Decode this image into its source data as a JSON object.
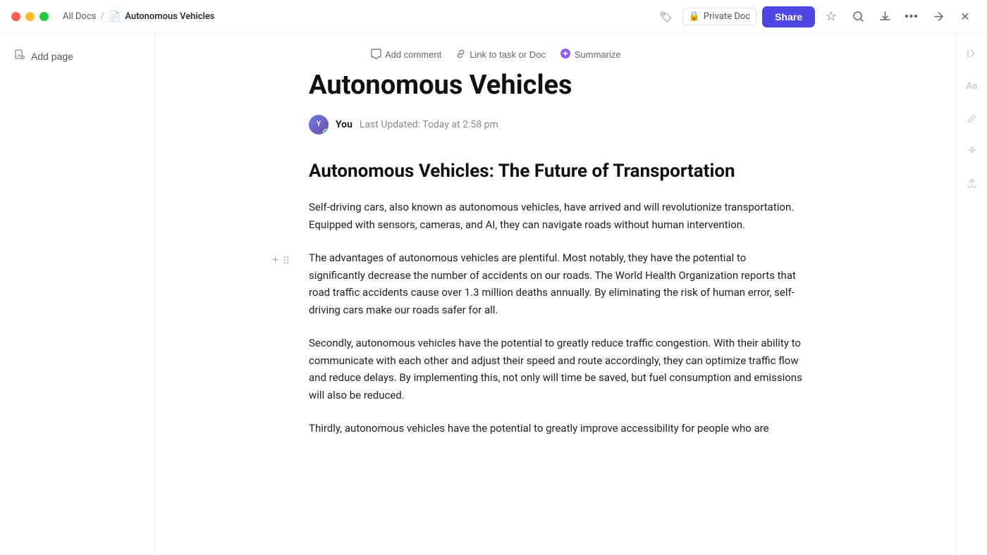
{
  "titlebar": {
    "breadcrumb_all_docs": "All Docs",
    "breadcrumb_separator": "/",
    "doc_title": "Autonomous Vehicles",
    "private_doc_label": "Private Doc",
    "share_label": "Share"
  },
  "sidebar": {
    "add_page_label": "Add page"
  },
  "toolbar": {
    "add_comment_label": "Add comment",
    "link_task_label": "Link to task or Doc",
    "summarize_label": "Summarize"
  },
  "document": {
    "title": "Autonomous Vehicles",
    "author": "You",
    "last_updated": "Last Updated: Today at 2:58 pm",
    "section_heading": "Autonomous Vehicles: The Future of Transportation",
    "paragraph1": "Self-driving cars, also known as autonomous vehicles, have arrived and will revolutionize transportation. Equipped with sensors, cameras, and AI, they can navigate roads without human intervention.",
    "paragraph2": "The advantages of autonomous vehicles are plentiful. Most notably, they have the potential to significantly decrease the number of accidents on our roads. The World Health Organization reports that road traffic accidents cause over 1.3 million deaths annually. By eliminating the risk of human error, self-driving cars make our roads safer for all.",
    "paragraph3": "Secondly, autonomous vehicles have the potential to greatly reduce traffic congestion. With their ability to communicate with each other and adjust their speed and route accordingly, they can optimize traffic flow and reduce delays. By implementing this, not only will time be saved, but fuel consumption and emissions will also be reduced.",
    "paragraph4": "Thirdly, autonomous vehicles have the potential to greatly improve accessibility for people who are"
  },
  "icons": {
    "tag": "🏷",
    "lock": "🔒",
    "star": "☆",
    "search": "⌕",
    "download": "↓",
    "more": "•••",
    "expand": "⤢",
    "close": "✕",
    "comment": "💬",
    "link": "⤴",
    "summarize_circle": "●",
    "add_page": "📄",
    "add_block": "+",
    "drag": "⠿",
    "right_collapse": "⇥",
    "font_size": "Aa",
    "pencil": "✏",
    "gear_sparkle": "✦",
    "upload": "↑"
  }
}
